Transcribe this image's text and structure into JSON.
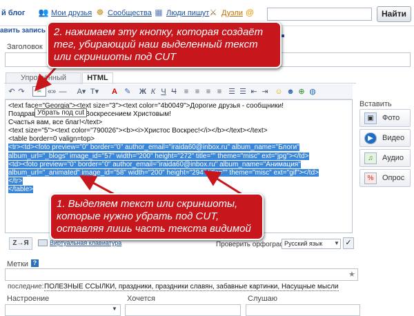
{
  "topnav": {
    "blog": "й блог",
    "friends": "Мои друзья",
    "communities": "Сообщества",
    "people_write": "Люди пишут",
    "duels": "Дуэли",
    "search_value": "",
    "find_button": "Найти"
  },
  "subnav": {
    "new_post": "авить запись"
  },
  "form": {
    "title_label": "Заголовок",
    "tab_simple": "Упрощённый формат",
    "tab_html": "HTML",
    "tags_label": "Метки",
    "tags_recent_label": "последние:",
    "tags_recent": "ПОЛЕЗНЫЕ ССЫЛКИ, праздники, праздники славян, забавные картинки, Насущные мысли",
    "mood_label": "Настроение",
    "want_label": "Хочется",
    "listening_label": "Слушаю"
  },
  "editor": {
    "tooltip": "Убрать под cut",
    "lines": [
      "<text face=\"Georgia\"><text size=\"3\"><text color=\"4b0049\">Дорогие друзья - сообщники!",
      "Поздрав",
      "Счастья вам, все благ!</text>",
      "<text size=\"5\"><text color=\"790026\"><b><i>Христос Воскрес!</i></b></text></text>",
      "<table border=0 valign=top>"
    ],
    "line2_rest": "Воскресением Христовым!",
    "selected_lines": [
      "<tr><td><foto preview=\"0\" border=\"0\"  author_email=\"iraida60@inbox.ru\" album_name=\"Блоги\"",
      "album_url=\"_blogs\" image_id=\"57\" width=\"200\" height=\"272\" title=\"\" theme=\"misc\" ext=\"jpg\"></td>",
      "<td><foto preview=\"0\" border=\"0\"  author_email=\"iraida60@inbox.ru\" album_name=\"Анимация\"",
      "album_url=\"_animated\" image_id=\"58\" width=\"200\" height=\"294\" title=\"\" theme=\"misc\" ext=\"gif\"></td>",
      "</tr>",
      "</table>"
    ],
    "translit_button": "Z→Я",
    "virtual_keyboard": "Виртуальная клавиатура",
    "spellcheck_label": "Проверить орфографию",
    "spell_lang": "Русский язык"
  },
  "insert": {
    "title": "Вставить",
    "photo": "Фото",
    "video": "Видео",
    "audio": "Аудио",
    "poll": "Опрос"
  },
  "callouts": {
    "top": "2. нажимаем эту кнопку, которая создаёт тег, убирающий наш выделенный текст или скриншоты под CUT",
    "bottom": "1. Выделяем текст или скриншоты, которые нужно убрать под CUT, оставляя лишь часть текста видимой"
  },
  "colors": {
    "callout": "#c8161d",
    "selection": "#3a86d8",
    "link": "#1e4e9c"
  }
}
